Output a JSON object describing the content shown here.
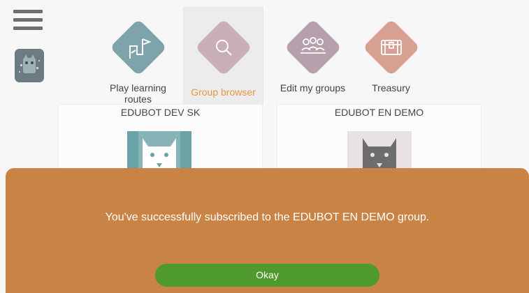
{
  "nav": {
    "items": [
      {
        "label": "Play learning routes",
        "icon": "route-signpost-icon",
        "color": "#7ea3ab"
      },
      {
        "label": "Group browser",
        "icon": "search-icon",
        "color": "#c9aeb6",
        "active": true
      },
      {
        "label": "Edit my groups",
        "icon": "people-group-icon",
        "color": "#b79fab"
      },
      {
        "label": "Treasury",
        "icon": "treasure-chest-icon",
        "color": "#d7a091"
      }
    ],
    "active_color": "#e8973f"
  },
  "groups": [
    {
      "title": "EDUBOT DEV SK",
      "avatar_color": "#6aa3a6"
    },
    {
      "title": "EDUBOT EN DEMO",
      "avatar_color": "#6d6d6d"
    }
  ],
  "dialog": {
    "message": "You've successfully subscribed to the EDUBOT EN DEMO group.",
    "button_label": "Okay",
    "background": "#c98345",
    "button_color": "#4f9a2c"
  }
}
